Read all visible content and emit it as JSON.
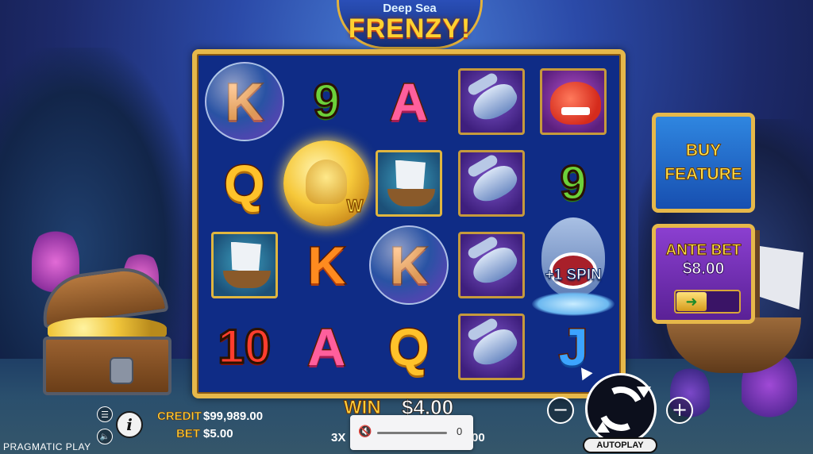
{
  "game": {
    "logo_top": "Deep Sea",
    "logo_main": "FRENZY!",
    "provider": "PRAGMATIC PLAY"
  },
  "reels": {
    "row1": [
      "K",
      "9",
      "A",
      "hammerhead-shark",
      "red-shark"
    ],
    "row2": [
      "Q",
      "octopus-wild",
      "pirate-ship",
      "hammerhead-shark",
      "9"
    ],
    "row3": [
      "pirate-ship",
      "K",
      "K",
      "hammerhead-shark",
      "spin-shark"
    ],
    "row4": [
      "10",
      "A",
      "Q",
      "hammerhead-shark",
      "J"
    ],
    "spin_label": "+1 SPIN",
    "wild_label": "W"
  },
  "side": {
    "buy_line1": "BUY",
    "buy_line2": "FEATURE",
    "ante_title": "ANTE BET",
    "ante_value": "$8.00",
    "ante_toggle_icon": "arrow-right-icon"
  },
  "bottom": {
    "credit_label": "CREDIT",
    "credit_value": "$99,989.00",
    "bet_label": "BET",
    "bet_value": "$5.00",
    "win_label": "WIN",
    "win_value": "$4.00",
    "multiplier": "3X",
    "partial_right": "00",
    "volume_value": "0",
    "autoplay_label": "AUTOPLAY",
    "minus": "−",
    "plus": "+",
    "info": "i",
    "menu_icon": "☰",
    "sound_icon": "🔈"
  },
  "colors": {
    "gold_frame": "#e6b84a",
    "reel_bg": "#0f2c86",
    "ante_purple": "#6a2aa8",
    "buy_blue": "#2167c9"
  }
}
